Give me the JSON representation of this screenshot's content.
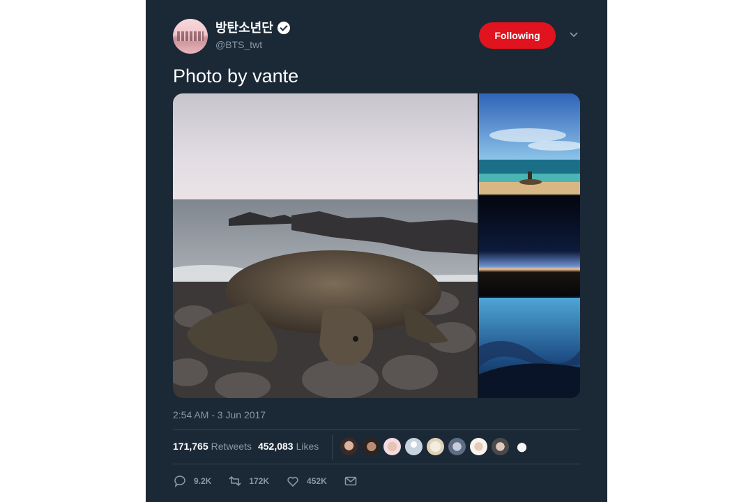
{
  "tweet": {
    "display_name": "방탄소년단",
    "handle": "@BTS_twt",
    "follow_label": "Following",
    "text": "Photo by vante",
    "timestamp": "2:54 AM - 3 Jun 2017"
  },
  "stats": {
    "retweets_count": "171,765",
    "retweets_label": "Retweets",
    "likes_count": "452,083",
    "likes_label": "Likes"
  },
  "actions": {
    "replies": "9.2K",
    "retweets": "172K",
    "likes": "452K"
  },
  "colors": {
    "background": "#1b2836",
    "follow_button": "#e0131e",
    "muted_text": "#8899a6"
  },
  "icons": [
    "verified-badge-icon",
    "chevron-down-icon",
    "reply-icon",
    "retweet-icon",
    "like-icon",
    "message-icon"
  ]
}
